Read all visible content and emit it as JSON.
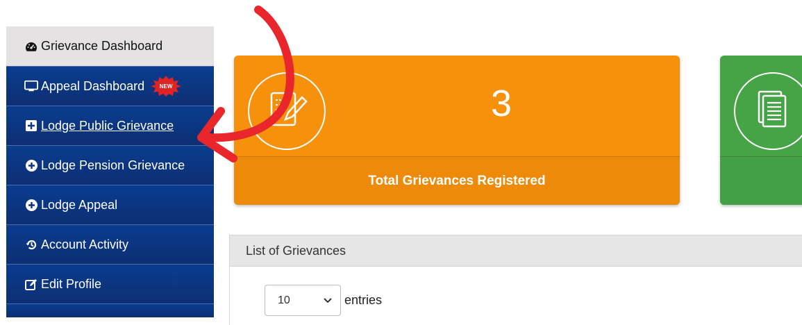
{
  "sidebar": {
    "items": [
      {
        "label": "Grievance Dashboard",
        "icon": "dashboard-icon"
      },
      {
        "label": "Appeal Dashboard",
        "icon": "monitor-icon",
        "badge": "NEW"
      },
      {
        "label": "Lodge Public Grievance",
        "icon": "plus-square-icon"
      },
      {
        "label": "Lodge Pension Grievance",
        "icon": "plus-circle-icon"
      },
      {
        "label": "Lodge Appeal",
        "icon": "plus-circle-icon"
      },
      {
        "label": "Account Activity",
        "icon": "history-icon"
      },
      {
        "label": "Edit Profile",
        "icon": "edit-icon"
      }
    ]
  },
  "cards": {
    "total": {
      "count": "3",
      "label": "Total Grievances Registered",
      "color": "#f7900a",
      "icon": "document-edit-icon"
    },
    "second": {
      "color": "#46a447",
      "icon": "documents-icon"
    }
  },
  "grievance_list": {
    "title": "List of Grievances",
    "page_size": "10",
    "entries_label": "entries"
  },
  "annotation": {
    "color": "#e8262b"
  }
}
